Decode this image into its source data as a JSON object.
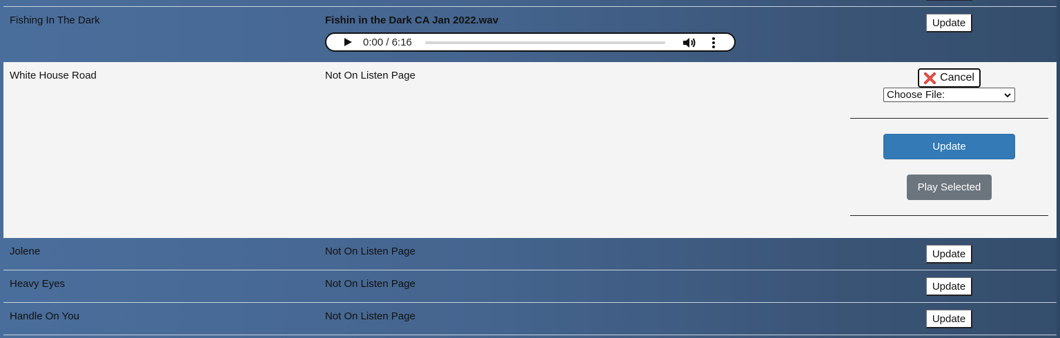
{
  "rows": [
    {
      "song": "Fishing In The Dark",
      "file": "Fishin in the Dark CA Jan 2022.wav",
      "update_label": "Update",
      "audio": {
        "time": "0:00 / 6:16"
      }
    },
    {
      "song": "White House Road",
      "file": "Not On Listen Page",
      "cancel_label": "Cancel",
      "select_value": "Choose File:",
      "update_label": "Update",
      "play_selected_label": "Play Selected"
    },
    {
      "song": "Jolene",
      "file": "Not On Listen Page",
      "update_label": "Update"
    },
    {
      "song": "Heavy Eyes",
      "file": "Not On Listen Page",
      "update_label": "Update"
    },
    {
      "song": "Handle On You",
      "file": "Not On Listen Page",
      "update_label": "Update"
    }
  ],
  "icons": {
    "cancel": "close-x-icon",
    "play": "play-icon",
    "volume": "volume-icon",
    "more": "more-vertical-icon",
    "dropdown": "chevron-down-icon"
  },
  "colors": {
    "primary_button": "#337ab7",
    "secondary_button": "#6c757d",
    "cancel_x": "#d0362f",
    "expanded_row_bg": "#f4f4f4"
  }
}
